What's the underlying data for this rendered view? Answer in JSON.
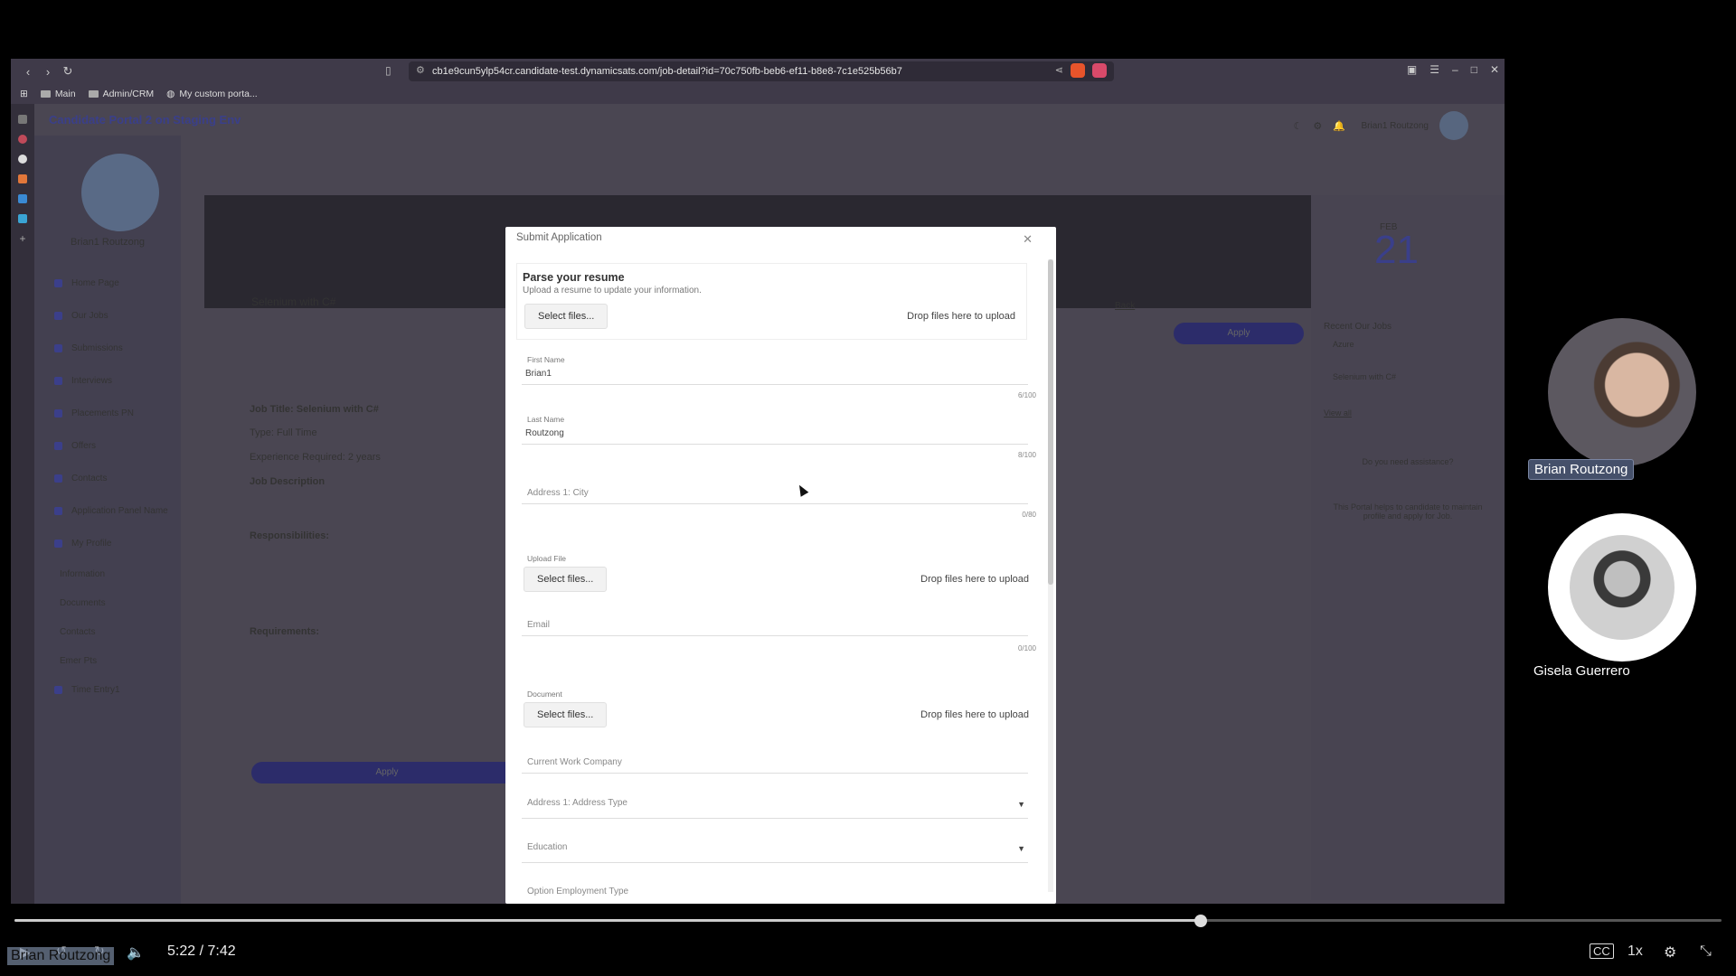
{
  "browser": {
    "url": "cb1e9cun5ylp54cr.candidate-test.dynamicsats.com/job-detail?id=70c750fb-beb6-ef11-b8e8-7c1e525b56b7",
    "bookmarks": [
      "Main",
      "Admin/CRM",
      "My custom porta..."
    ]
  },
  "portal": {
    "title": "Candidate Portal 2 on Staging Env",
    "user_name": "Brian1 Routzong",
    "nav_items": [
      "Home Page",
      "Our Jobs",
      "Submissions",
      "Interviews",
      "Placements PN",
      "Offers",
      "Contacts",
      "Application Panel Name",
      "My Profile",
      "Information",
      "Documents",
      "Contacts",
      "Emer Pts",
      "Time Entry1"
    ],
    "job_title": "Selenium with C#",
    "back_label": "Back",
    "apply_label": "Apply",
    "job_title_line": "Job Title: Selenium with C#",
    "type_line": "Type: Full Time",
    "experience_line": "Experience Required: 2 years",
    "job_description_heading": "Job Description",
    "responsibilities_heading": "Responsibilities:",
    "requirements_heading": "Requirements:",
    "date_day": "21",
    "date_month": "FEB",
    "recent_jobs_heading": "Recent Our Jobs",
    "recent_jobs": [
      "Azure",
      "Selenium with C#"
    ],
    "view_all": "View all",
    "assistance": "Do you need assistance?",
    "about_portal": "This Portal helps to candidate to maintain profile and apply for Job."
  },
  "modal": {
    "title": "Submit Application",
    "close_icon": "close-icon",
    "parse_heading": "Parse your resume",
    "parse_sub": "Upload a resume to update your information.",
    "select_files": "Select files...",
    "drop_files": "Drop files here to upload",
    "first_name_label": "First Name",
    "first_name_value": "Brian1",
    "first_name_count": "6/100",
    "last_name_label": "Last Name",
    "last_name_value": "Routzong",
    "last_name_count": "8/100",
    "city_placeholder": "Address 1: City",
    "city_count": "0/80",
    "upload_file_label": "Upload File",
    "email_placeholder": "Email",
    "email_count": "0/100",
    "document_label": "Document",
    "company_placeholder": "Current Work Company",
    "address_type_placeholder": "Address 1: Address Type",
    "education_placeholder": "Education",
    "employment_type_placeholder": "Option Employment Type"
  },
  "participants": [
    {
      "name": "Brian Routzong"
    },
    {
      "name": "Gisela Guerrero"
    }
  ],
  "player": {
    "time": "5:22 / 7:42",
    "progress_fraction": 0.695,
    "speed": "1x",
    "caption": "Brian Routzong"
  }
}
